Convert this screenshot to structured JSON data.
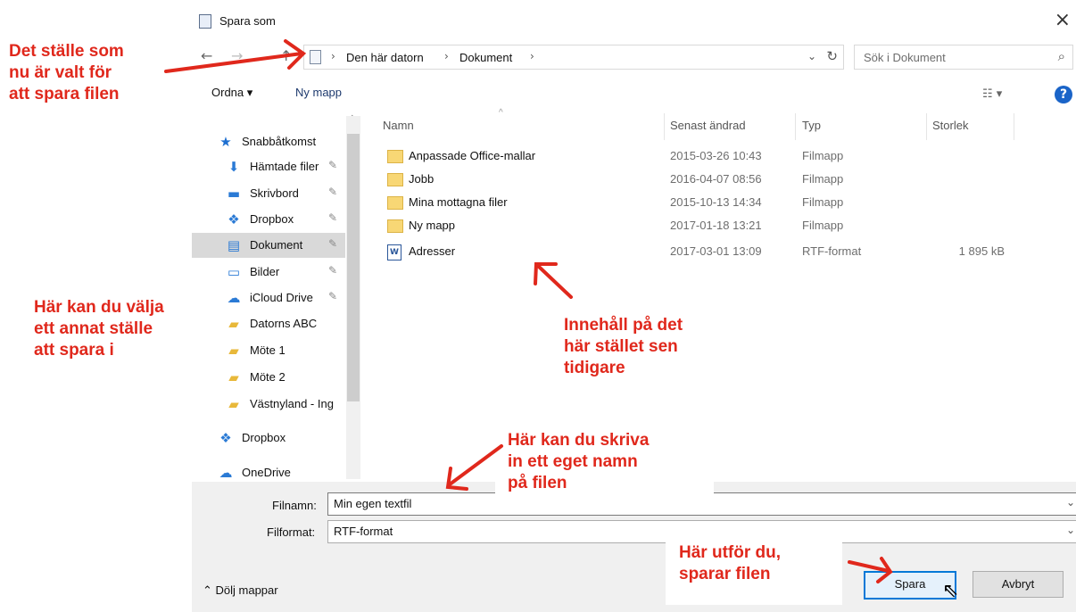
{
  "dialog": {
    "title": "Spara som",
    "close": "×",
    "nav": {
      "back": "←",
      "forward": "→",
      "recent": "⌄",
      "up": "↑"
    },
    "breadcrumb": [
      "Den här datorn",
      "Dokument"
    ],
    "search_placeholder": "Sök i Dokument",
    "toolbar": {
      "organize": "Ordna ▾",
      "new_folder": "Ny mapp",
      "help": "?"
    },
    "sidebar": [
      {
        "label": "Snabbåtkomst",
        "icon": "star-icon",
        "glyph": "★"
      },
      {
        "label": "Hämtade filer",
        "icon": "download-icon",
        "glyph": "⬇"
      },
      {
        "label": "Skrivbord",
        "icon": "desktop-icon",
        "glyph": "▬"
      },
      {
        "label": "Dropbox",
        "icon": "dropbox-icon",
        "glyph": "❖"
      },
      {
        "label": "Dokument",
        "icon": "document-icon",
        "glyph": "▤"
      },
      {
        "label": "Bilder",
        "icon": "pictures-icon",
        "glyph": "▭"
      },
      {
        "label": "iCloud Drive",
        "icon": "cloud-icon",
        "glyph": "☁"
      },
      {
        "label": "Datorns ABC",
        "icon": "folder-icon",
        "glyph": "▰"
      },
      {
        "label": "Möte 1",
        "icon": "folder-icon",
        "glyph": "▰"
      },
      {
        "label": "Möte 2",
        "icon": "folder-icon",
        "glyph": "▰"
      },
      {
        "label": "Västnyland - Ing",
        "icon": "folder-icon",
        "glyph": "▰"
      },
      {
        "label": "Dropbox",
        "icon": "dropbox-icon",
        "glyph": "❖"
      },
      {
        "label": "OneDrive",
        "icon": "onedrive-icon",
        "glyph": "☁"
      }
    ],
    "columns": {
      "name": "Namn",
      "modified": "Senast ändrad",
      "type": "Typ",
      "size": "Storlek"
    },
    "files": [
      {
        "name": "Anpassade Office-mallar",
        "modified": "2015-03-26 10:43",
        "type": "Filmapp",
        "size": "",
        "kind": "folder"
      },
      {
        "name": "Jobb",
        "modified": "2016-04-07 08:56",
        "type": "Filmapp",
        "size": "",
        "kind": "folder"
      },
      {
        "name": "Mina mottagna filer",
        "modified": "2015-10-13 14:34",
        "type": "Filmapp",
        "size": "",
        "kind": "folder"
      },
      {
        "name": "Ny mapp",
        "modified": "2017-01-18 13:21",
        "type": "Filmapp",
        "size": "",
        "kind": "folder"
      },
      {
        "name": "Adresser",
        "modified": "2017-03-01 13:09",
        "type": "RTF-format",
        "size": "1 895 kB",
        "kind": "word"
      }
    ],
    "filename_label": "Filnamn:",
    "filename_value": "Min egen textfil",
    "format_label": "Filformat:",
    "format_value": "RTF-format",
    "hide_folders": "Dölj mappar",
    "save": "Spara",
    "cancel": "Avbryt"
  },
  "annotations": {
    "location": "Det ställe som\nnu är valt för\natt spara filen",
    "choose": "Här kan du välja\nett annat ställe\natt spara i",
    "content": "Innehåll på det\nhär stället sen\ntidigare",
    "filename": "Här kan du skriva\nin ett eget namn\npå filen",
    "save": "Här utför du,\nsparar filen"
  },
  "colors": {
    "annotation": "#e0281c",
    "accent": "#0078d7"
  }
}
